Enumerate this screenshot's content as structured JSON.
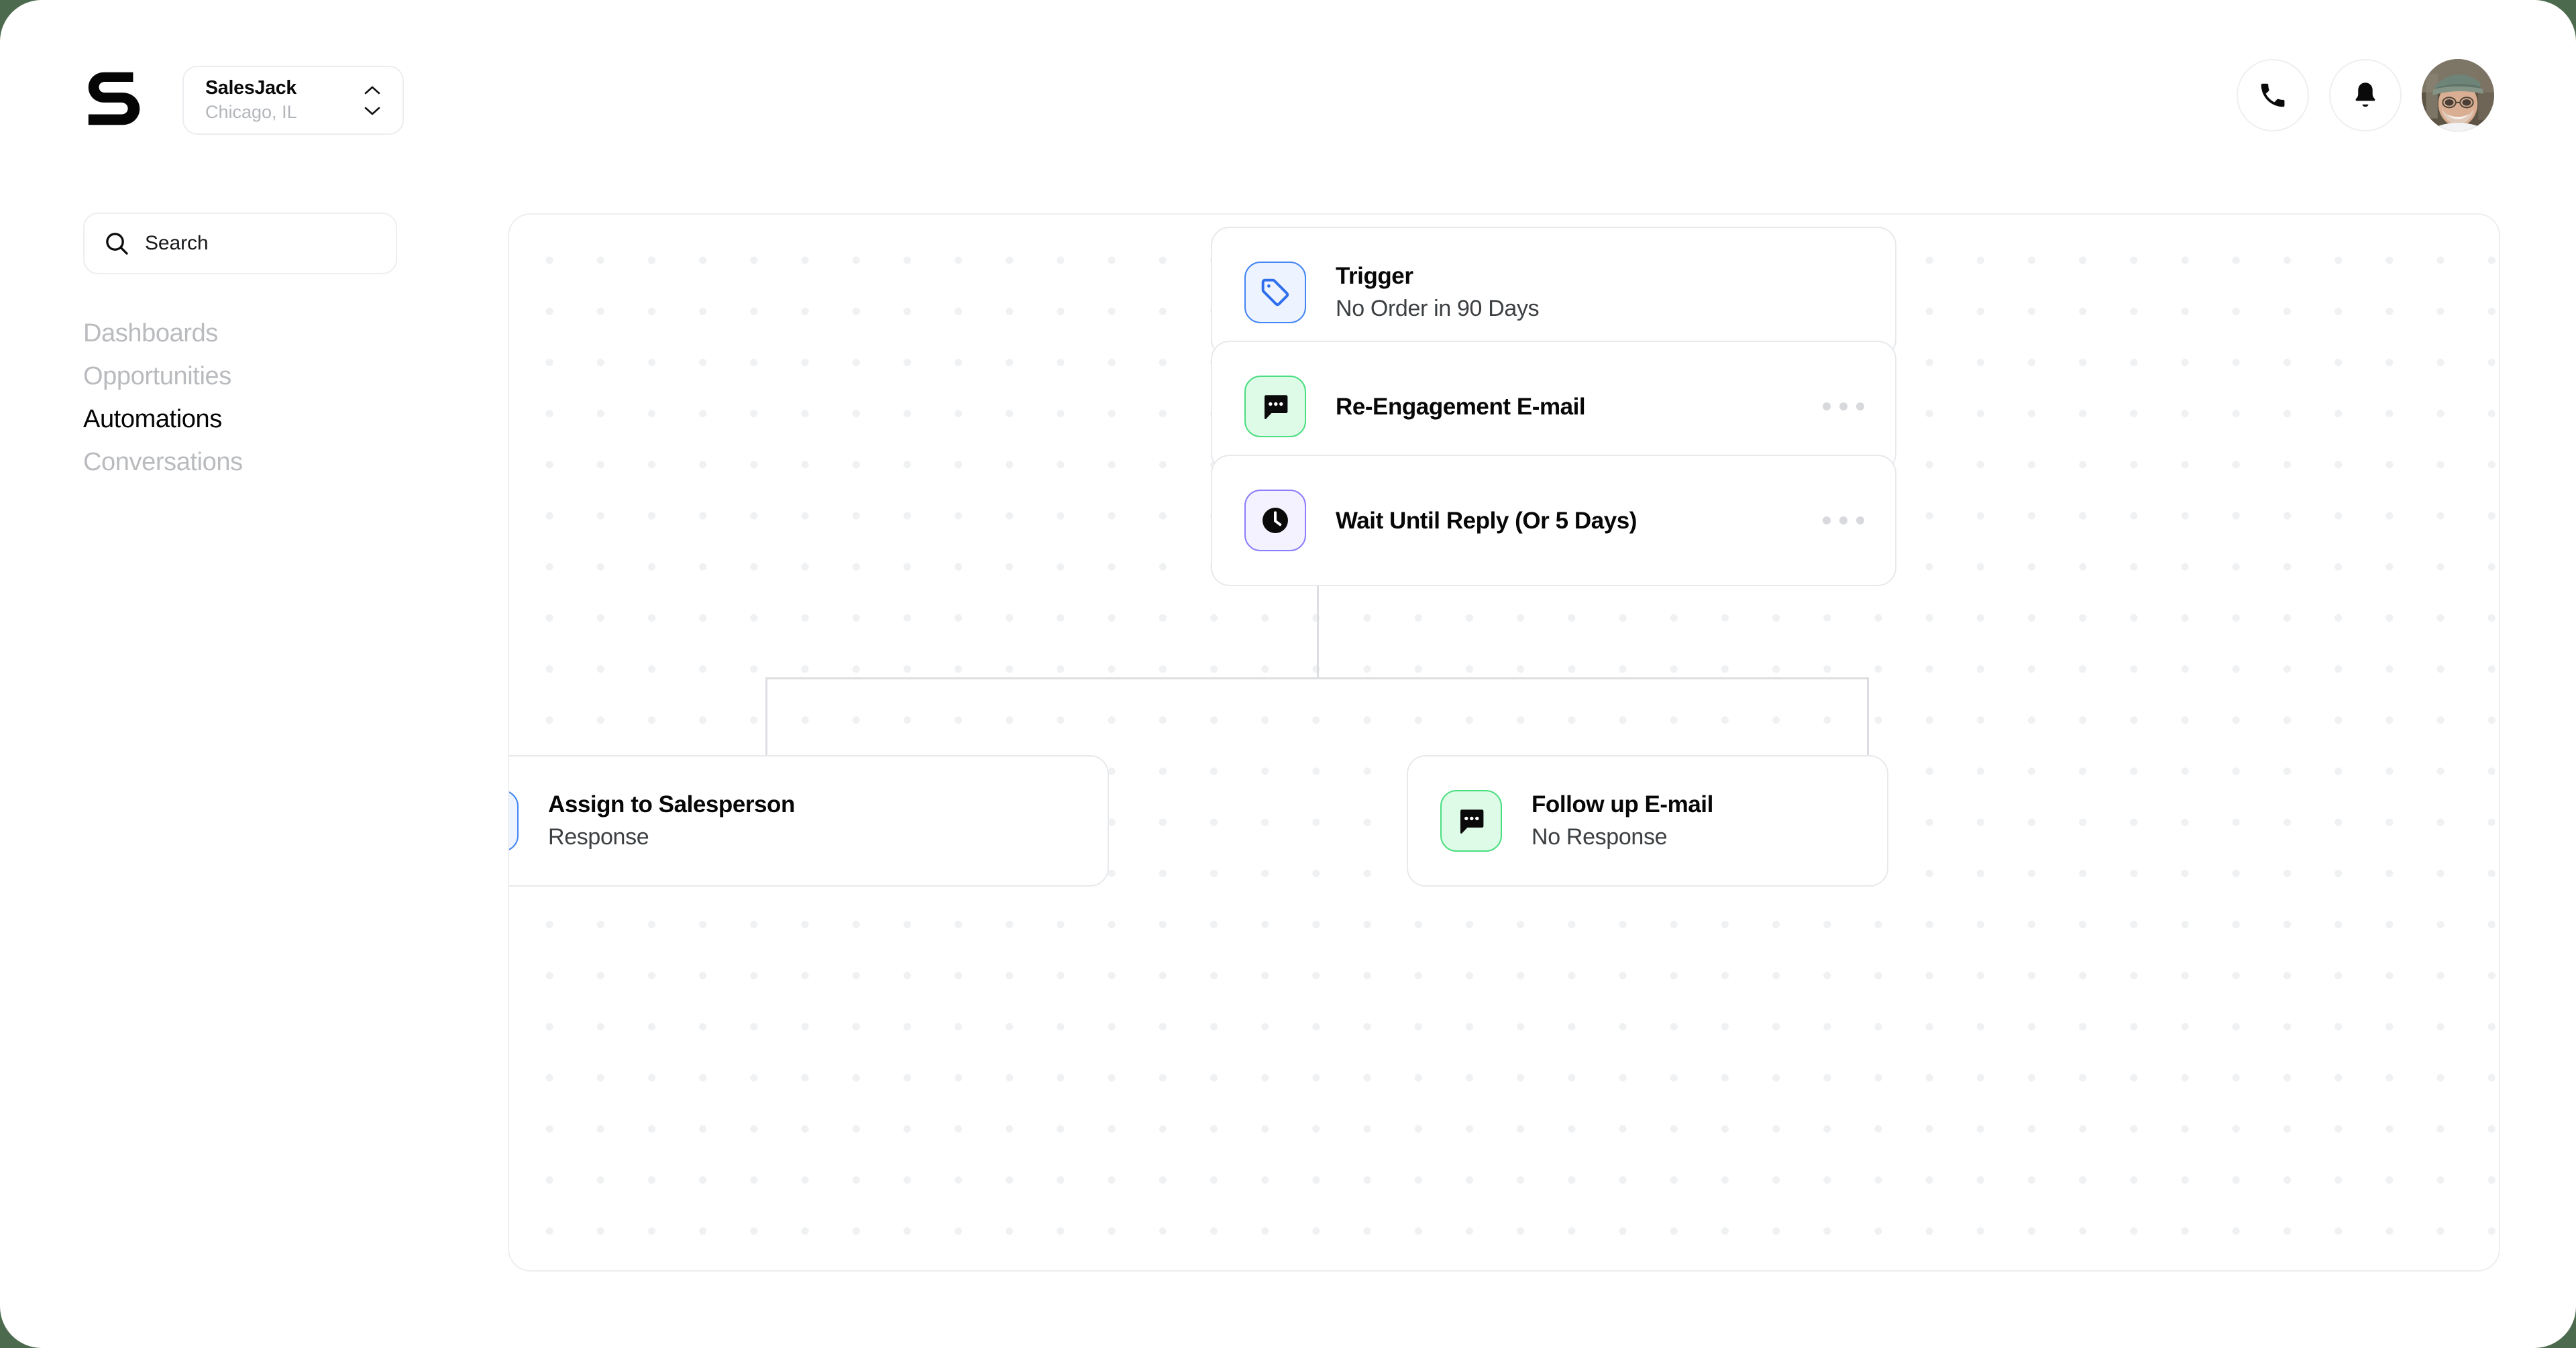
{
  "app": {
    "logo_name": "s-logo",
    "background_color": "#4b6a4e"
  },
  "topbar": {
    "workspace": {
      "name": "SalesJack",
      "location": "Chicago, IL",
      "chevron_icon": "chevron-up-down-icon"
    },
    "actions": [
      {
        "name": "phone-icon",
        "label": "Call"
      },
      {
        "name": "bell-icon",
        "label": "Notifications"
      }
    ],
    "avatar_label": "User profile"
  },
  "sidebar": {
    "search": {
      "icon": "search-icon",
      "placeholder": "Search",
      "value": "Search"
    },
    "items": [
      {
        "label": "Dashboards",
        "active": false
      },
      {
        "label": "Opportunities",
        "active": false
      },
      {
        "label": "Automations",
        "active": true
      },
      {
        "label": "Conversations",
        "active": false
      }
    ]
  },
  "canvas": {
    "add_button_label": "+",
    "menu_label": "More options",
    "nodes": [
      {
        "id": "trigger",
        "title": "Trigger",
        "subtitle": "No Order in 90 Days",
        "icon": "tag-icon",
        "icon_theme": "blue",
        "icon_bg": "#eef4ff",
        "icon_border": "#4285f4",
        "has_menu": false
      },
      {
        "id": "re-engagement-email",
        "title": "Re-Engagement E-mail",
        "subtitle": "",
        "icon": "message-bubble-icon",
        "icon_theme": "green",
        "icon_bg": "#ddfbe6",
        "icon_border": "#4ade80",
        "has_menu": true
      },
      {
        "id": "wait-until-reply",
        "title": "Wait Until Reply (Or 5 Days)",
        "subtitle": "",
        "icon": "clock-icon",
        "icon_theme": "violet",
        "icon_bg": "#f4f2ff",
        "icon_border": "#8b7dfb",
        "has_menu": true
      },
      {
        "id": "assign-to-salesperson",
        "title": "Assign to Salesperson",
        "subtitle": "Response",
        "icon": "user-check-icon",
        "icon_theme": "blue",
        "icon_bg": "#eef4ff",
        "icon_border": "#4285f4",
        "has_menu": false
      },
      {
        "id": "follow-up-email",
        "title": "Follow up E-mail",
        "subtitle": "No Response",
        "icon": "message-bubble-icon",
        "icon_theme": "green",
        "icon_bg": "#ddfbe6",
        "icon_border": "#4ade80",
        "has_menu": false
      }
    ]
  }
}
